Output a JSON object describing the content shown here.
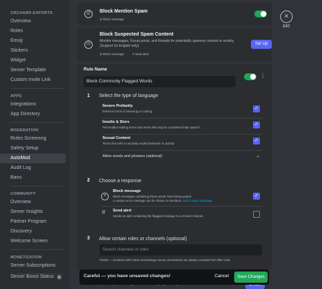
{
  "sidebar": {
    "sections": [
      {
        "header": "ORCHARD EXPORTS",
        "items": [
          "Overview",
          "Roles",
          "Emoji",
          "Stickers",
          "Widget",
          "Server Template",
          "Custom Invite Link"
        ]
      },
      {
        "header": "APPS",
        "items": [
          "Integrations",
          "App Directory"
        ]
      },
      {
        "header": "MODERATION",
        "items": [
          "Rules Screening",
          "Safety Setup",
          "AutoMod",
          "Audit Log",
          "Bans"
        ]
      },
      {
        "header": "COMMUNITY",
        "items": [
          "Overview",
          "Server Insights",
          "Partner Program",
          "Discovery",
          "Welcome Screen"
        ]
      },
      {
        "header": "MONETIZATION",
        "items": [
          "Server Subscriptions"
        ]
      }
    ],
    "active_item": "AutoMod",
    "status_item": "Server Boost Status"
  },
  "mention_spam": {
    "title": "Block Mention Spam",
    "tag": "block message"
  },
  "spam_content": {
    "title": "Block Suspected Spam Content",
    "desc": "Monitor messages, Forum posts, and threads for potentially spammy content or activity. (Support for English only)",
    "tags": [
      "block message",
      "send alert"
    ],
    "setup_label": "Set Up"
  },
  "rule": {
    "name_label": "Rule Name",
    "name_value": "Block Commonly Flagged Words",
    "more_icon": "⋮"
  },
  "step1": {
    "num": "1",
    "label": "Select the type of language",
    "options": [
      {
        "title": "Severe Profanity",
        "desc": "Extreme forms of swearing or cursing"
      },
      {
        "title": "Insults & Slurs",
        "desc": "Personally insulting terms and terms that may be considered hate speech"
      },
      {
        "title": "Sexual Content",
        "desc": "Terms that refer to sexually explicit behavior or activity"
      }
    ],
    "allow_label": "Allow words and phrases (optional)"
  },
  "step2": {
    "num": "2",
    "label": "Choose a response",
    "block": {
      "title": "Block message",
      "desc1": "Block messages containing these words from being posted.",
      "desc2": "A custom error message can be shown to members.",
      "link": "Edit Custom Message"
    },
    "alert": {
      "title": "Send alert",
      "desc": "Sends an alert containing the flagged message to a chosen channel."
    }
  },
  "step3": {
    "num": "3",
    "label": "Allow certain roles or channels (optional)",
    "search_placeholder": "Search channels or roles",
    "note": "Psssst — members with Admin and Manage Server permissions are always excluded from filter rules"
  },
  "bottom_peek": {
    "text": "prevent your own high or custom language from your server.",
    "create_label": "Create"
  },
  "close": {
    "label": "ESC"
  },
  "unsaved_bar": {
    "message": "Careful — you have unsaved changes!",
    "cancel_label": "Cancel",
    "save_label": "Save Changes"
  },
  "colors": {
    "accent": "#5865f2",
    "success": "#23a55a",
    "link": "#00a8fc"
  }
}
